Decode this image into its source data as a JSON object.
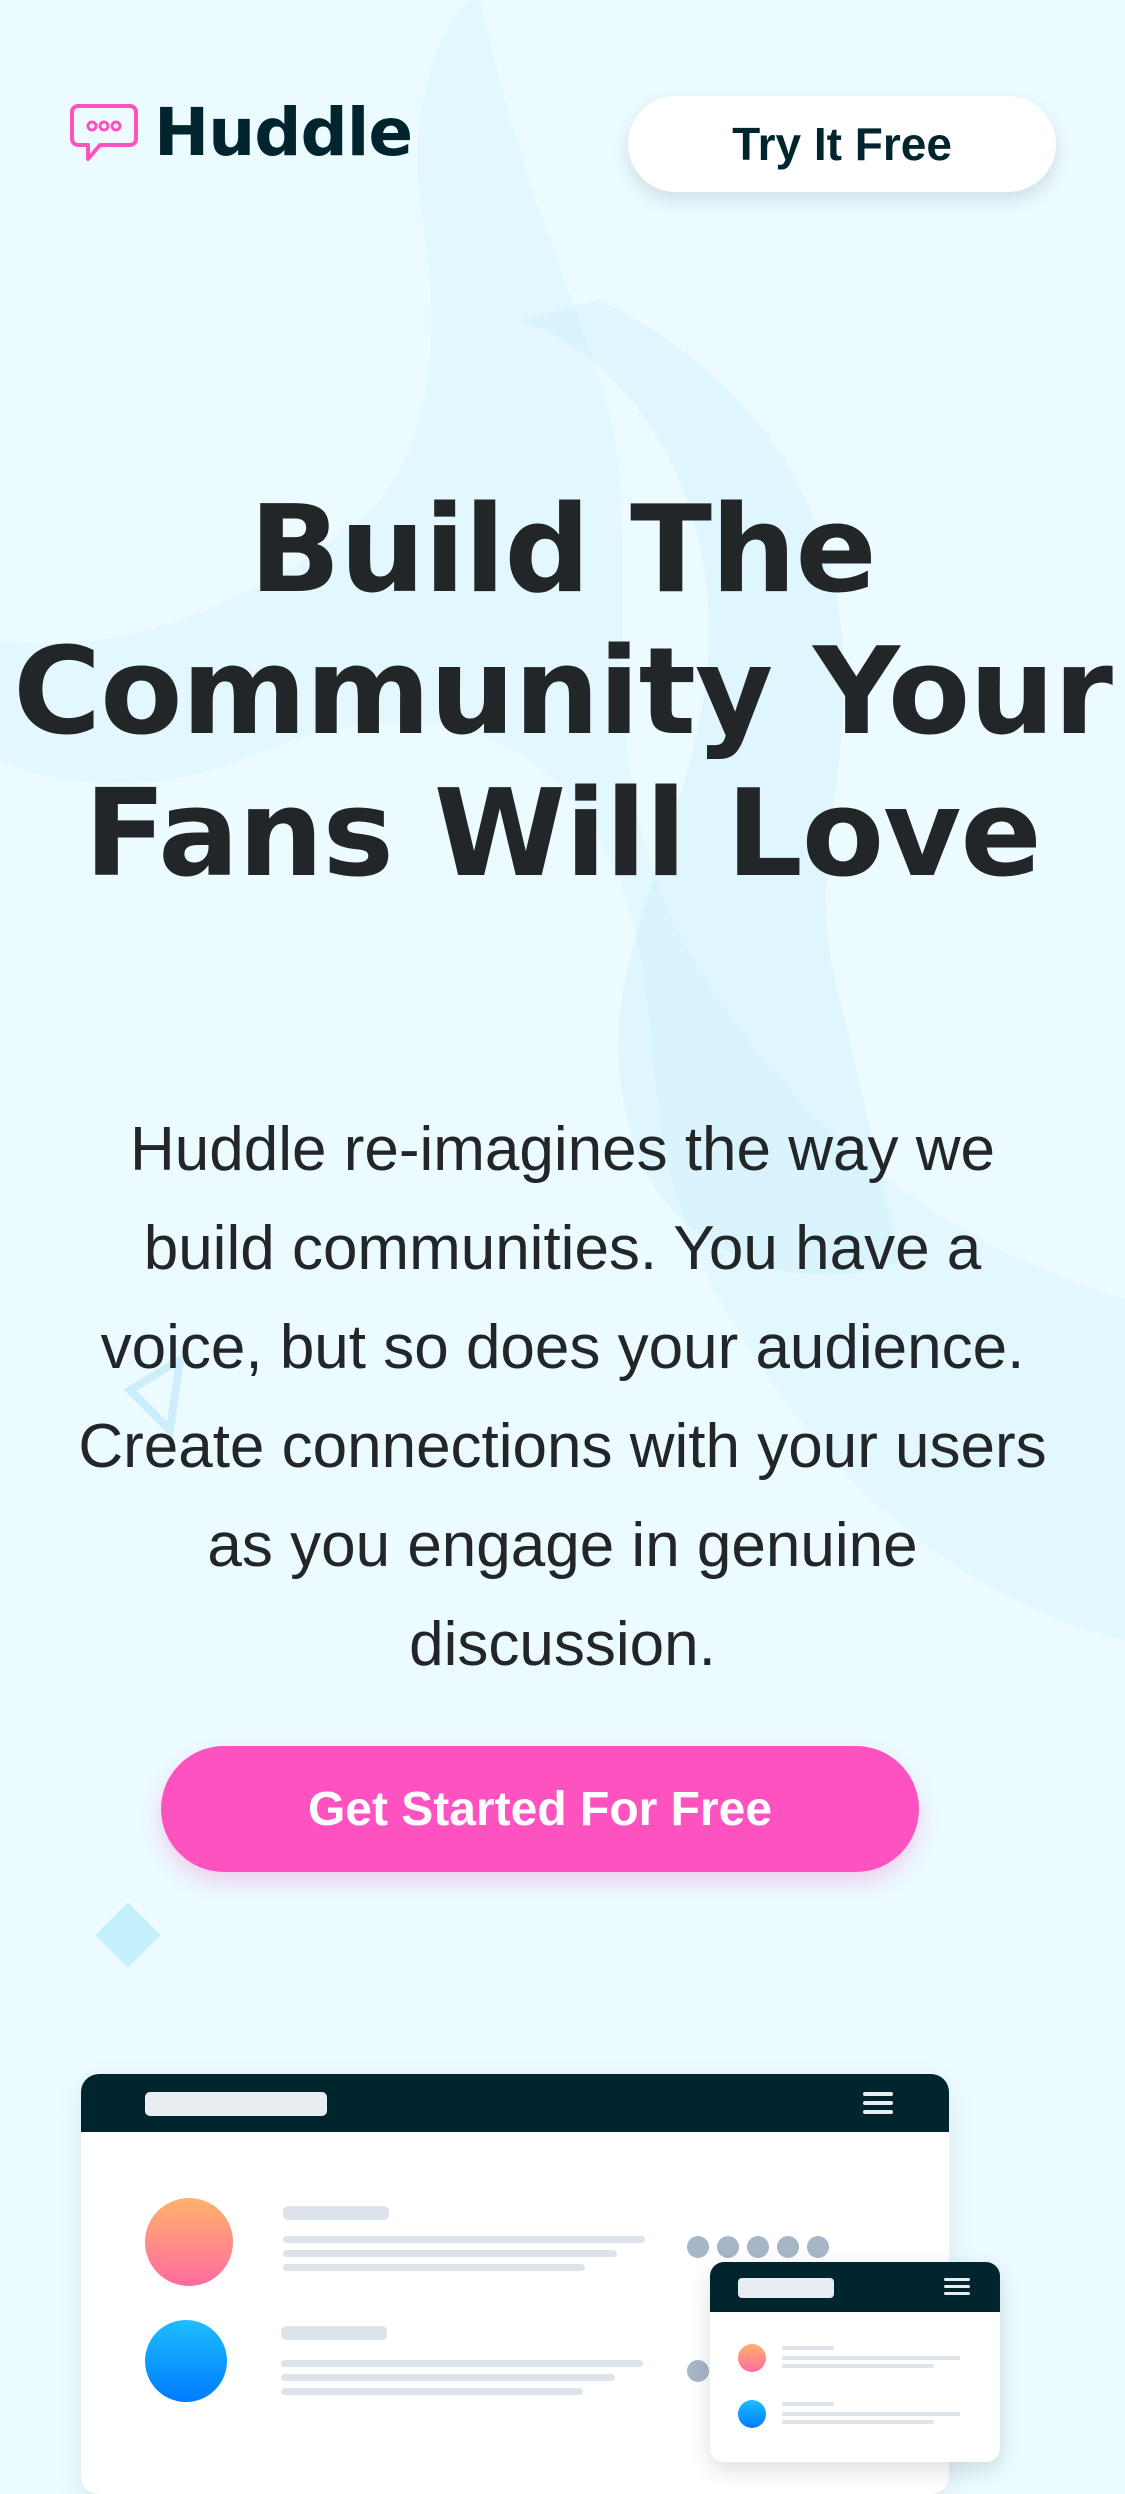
{
  "header": {
    "logo_text": "Huddle",
    "logo_icon": "chat-bubble-icon",
    "cta_label": "Try It Free"
  },
  "hero": {
    "title": "Build The Community Your Fans Will Love",
    "description": "Huddle re-imagines the way we build communities. You have a voice, but so does your audience. Create connections with your users as you engage in genuine discussion.",
    "cta_label": "Get Started For Free"
  },
  "mockup": {
    "desktop_icons": [
      "menu-icon"
    ],
    "phone_icons": [
      "menu-icon"
    ]
  },
  "colors": {
    "background": "#ebfbff",
    "dark": "#00252e",
    "pink": "#ff52c1",
    "text": "#232628"
  }
}
